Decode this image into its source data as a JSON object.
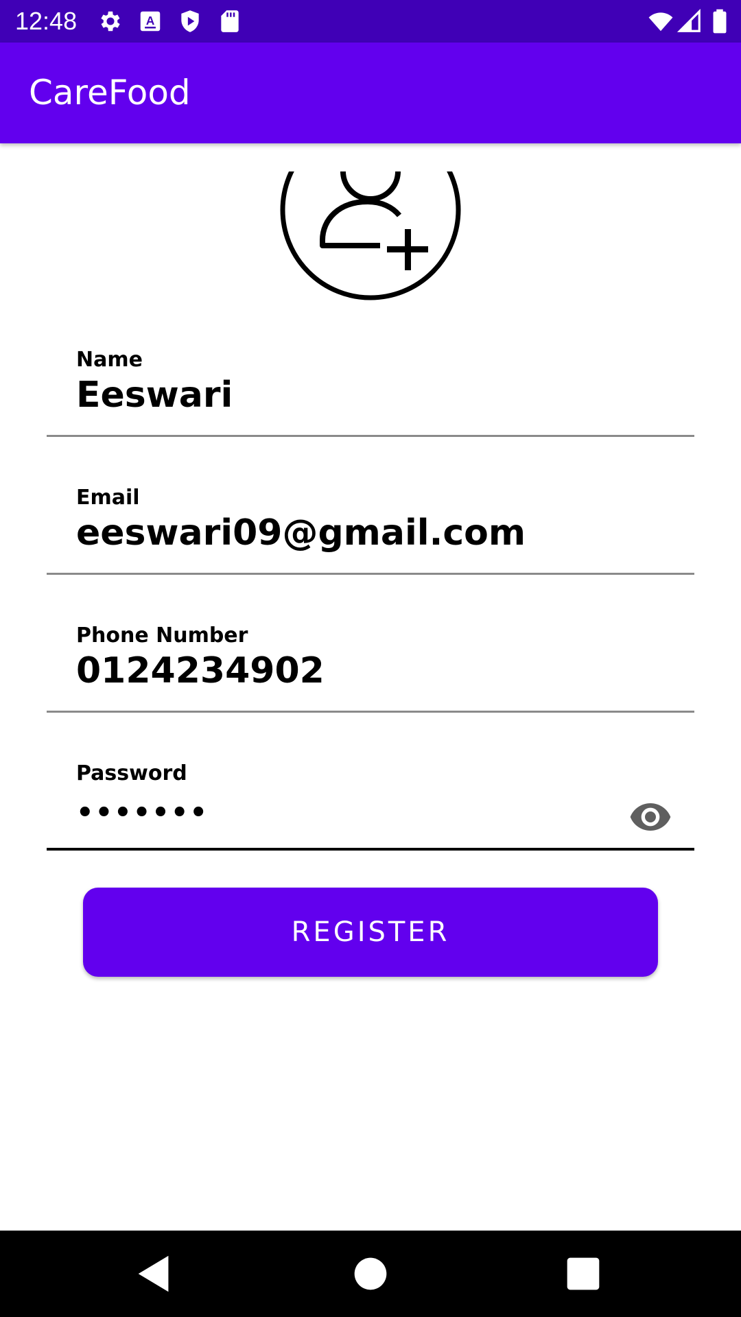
{
  "status_bar": {
    "time": "12:48",
    "left_icons": [
      "gear-icon",
      "keyboard-a-icon",
      "play-shield-icon",
      "sd-card-icon"
    ],
    "right_icons": [
      "wifi-icon",
      "signal-icon",
      "battery-icon"
    ]
  },
  "app_bar": {
    "title": "CareFood"
  },
  "avatar": {
    "icon": "add-user-icon"
  },
  "form": {
    "name": {
      "label": "Name",
      "value": "Eeswari"
    },
    "email": {
      "label": "Email",
      "value": "eeswari09@gmail.com"
    },
    "phone": {
      "label": "Phone Number",
      "value": "0124234902"
    },
    "password": {
      "label": "Password",
      "value": "•••••••",
      "toggle_icon": "eye-icon"
    }
  },
  "register_button": {
    "label": "REGISTER"
  },
  "nav_bar": {
    "buttons": [
      "back-icon",
      "home-icon",
      "recents-icon"
    ]
  },
  "colors": {
    "status_bar": "#4000b6",
    "primary": "#6200ee",
    "text": "#000000",
    "underline": "#8a8a8a"
  }
}
